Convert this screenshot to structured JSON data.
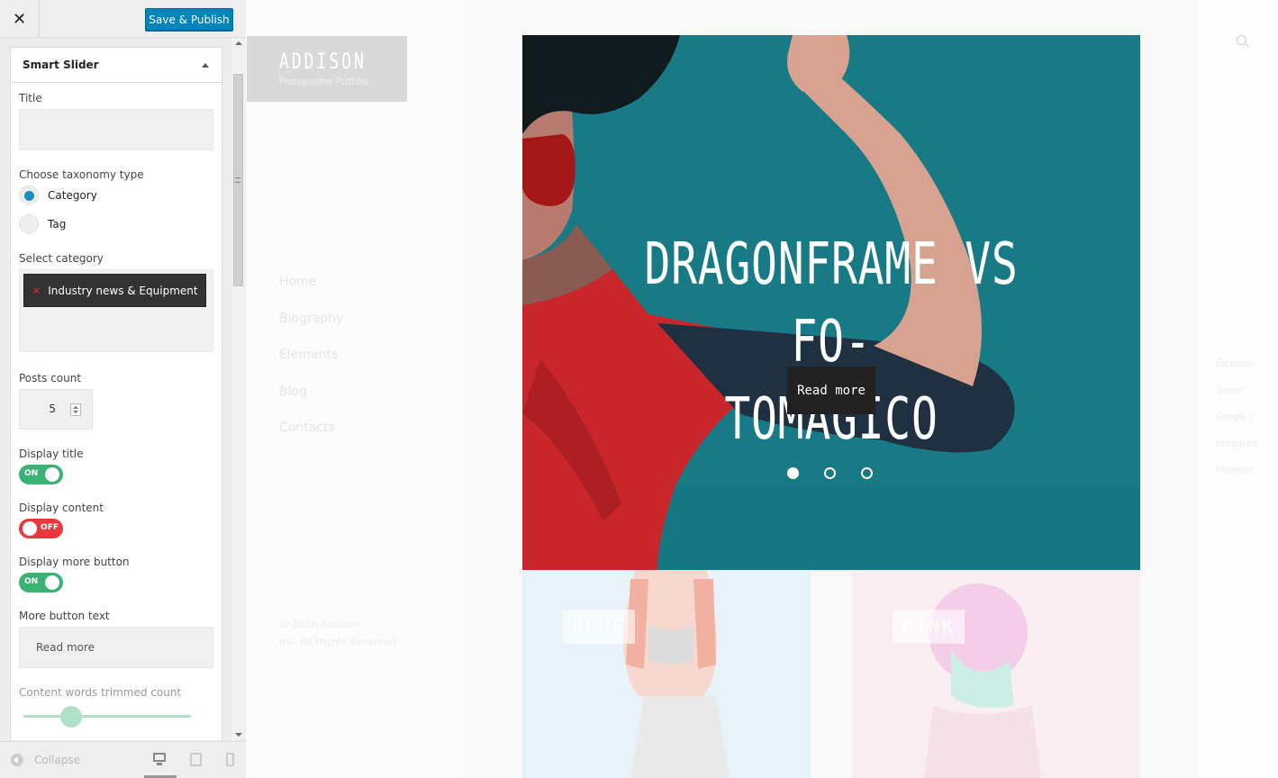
{
  "panel": {
    "close_glyph": "✕",
    "save_label": "Save & Publish",
    "section_title": "Smart Slider",
    "title_label": "Title",
    "title_value": "",
    "taxonomy_label": "Choose taxonomy type",
    "taxonomy_options": [
      {
        "label": "Category",
        "checked": true
      },
      {
        "label": "Tag",
        "checked": false
      }
    ],
    "select_category_label": "Select category",
    "selected_category": "Industry news & Equipment",
    "remove_glyph": "×",
    "posts_count_label": "Posts count",
    "posts_count_value": "5",
    "display_title_label": "Display title",
    "display_title_state": "ON",
    "display_content_label": "Display content",
    "display_content_state": "OFF",
    "display_more_label": "Display more button",
    "display_more_state": "ON",
    "more_text_label": "More button text",
    "more_text_value": "Read more",
    "trim_label": "Content words trimmed count",
    "trim_value_fraction": 0.3,
    "collapse_label": "Collapse"
  },
  "site": {
    "logo_title": "ADDISON",
    "logo_subtitle": "Photographer Portfolio",
    "nav": [
      {
        "label": "Home",
        "has_submenu": true
      },
      {
        "label": "Biography",
        "has_submenu": false
      },
      {
        "label": "Elements",
        "has_submenu": false
      },
      {
        "label": "Blog",
        "has_submenu": true
      },
      {
        "label": "Contacts",
        "has_submenu": false
      }
    ],
    "chevron_glyph": "›",
    "copyright_line1": "© 2016 Addison.",
    "copyright_line2": "Inc. All Rights Reserved",
    "hero_title_line1": "DRAGONFRAME VS FO-",
    "hero_title_line2": "TOMAGICO",
    "hero_button": "Read more",
    "slider_dots": 3,
    "active_dot": 0,
    "card_blue_label": "BLUE",
    "card_pink_label": "PINK",
    "social": [
      "Facebook",
      "Twitter",
      "Google +",
      "Instagram",
      "Pinterest"
    ]
  },
  "colors": {
    "accent": "#0085ba",
    "toggle_on": "#3bb273",
    "toggle_off": "#e8383d",
    "hero_teal": "#177a85",
    "hero_red": "#c8262a"
  }
}
